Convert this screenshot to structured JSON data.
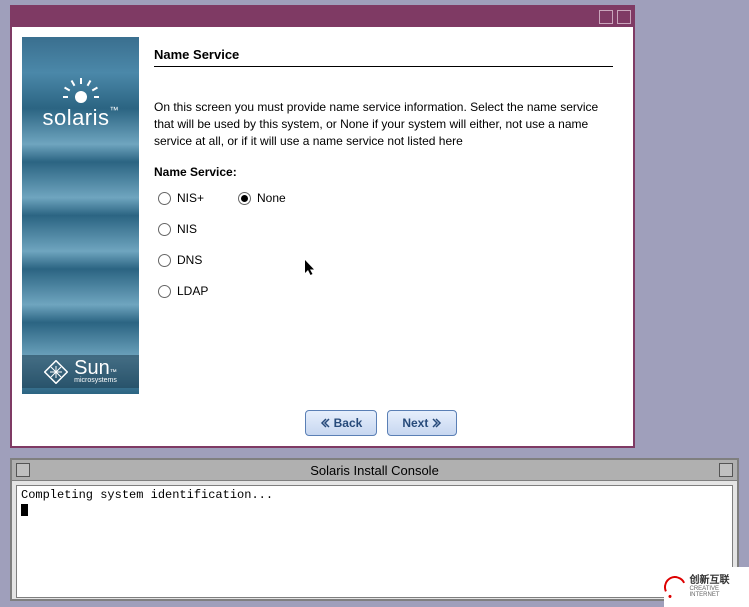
{
  "installer": {
    "screen_title": "Name Service",
    "description": "On this screen you must provide name service information.  Select the name service that will be used by this system, or None if your system will either, not use a name service at all, or if it will use a name service not listed here",
    "field_label": "Name Service:",
    "options": {
      "nis_plus": {
        "label": "NIS+",
        "selected": false
      },
      "none": {
        "label": "None",
        "selected": true
      },
      "nis": {
        "label": "NIS",
        "selected": false
      },
      "dns": {
        "label": "DNS",
        "selected": false
      },
      "ldap": {
        "label": "LDAP",
        "selected": false
      }
    },
    "buttons": {
      "back": "Back",
      "next": "Next"
    },
    "brand": {
      "product": "solaris",
      "vendor": "Sun",
      "vendor_sub": "microsystems"
    }
  },
  "console": {
    "title": "Solaris Install Console",
    "output": "Completing system identification..."
  },
  "corner_brand": {
    "main": "创新互联",
    "sub": "CREATIVE INTERNET"
  }
}
